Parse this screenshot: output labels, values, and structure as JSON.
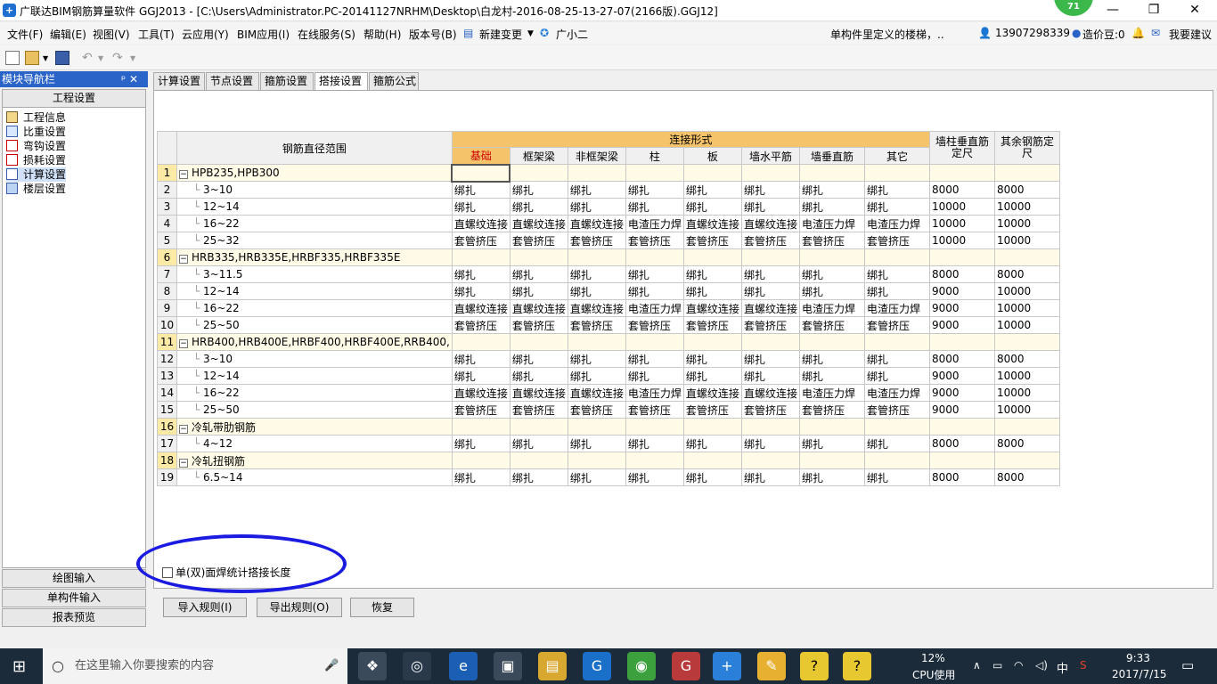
{
  "window": {
    "title": "广联达BIM钢筋算量软件 GGJ2013 - [C:\\Users\\Administrator.PC-20141127NRHM\\Desktop\\白龙村-2016-08-25-13-27-07(2166版).GGJ12]",
    "badge": "71",
    "controls": [
      "—",
      "❐",
      "✕"
    ]
  },
  "menubar": {
    "items": [
      "文件(F)",
      "编辑(E)",
      "视图(V)",
      "工具(T)",
      "云应用(Y)",
      "BIM应用(I)",
      "在线服务(S)",
      "帮助(H)",
      "版本号(B)",
      "新建变更",
      "广小二"
    ],
    "notice": "单构件里定义的楼梯，..",
    "phone": "13907298339",
    "coins": "造价豆:0",
    "suggest": "我要建议"
  },
  "nav": {
    "header": "模块导航栏",
    "pin": "ᵖ ✕",
    "section": "工程设置",
    "items": [
      "工程信息",
      "比重设置",
      "弯钩设置",
      "损耗设置",
      "计算设置",
      "楼层设置"
    ],
    "bottom": [
      "绘图输入",
      "单构件输入",
      "报表预览"
    ]
  },
  "tabs": [
    "计算设置",
    "节点设置",
    "箍筋设置",
    "搭接设置",
    "箍筋公式"
  ],
  "grid": {
    "header_range": "钢筋直径范围",
    "header_group": "连接形式",
    "columns": [
      "基础",
      "框架梁",
      "非框架梁",
      "柱",
      "板",
      "墙水平筋",
      "墙垂直筋",
      "其它"
    ],
    "header_wall": "墙柱垂直筋定尺",
    "header_other": "其余钢筋定尺",
    "rows": [
      {
        "n": "1",
        "group": true,
        "label": "HPB235,HPB300",
        "cells": [
          "",
          "",
          "",
          "",
          "",
          "",
          "",
          "",
          "",
          ""
        ]
      },
      {
        "n": "2",
        "group": false,
        "label": "3~10",
        "cells": [
          "绑扎",
          "绑扎",
          "绑扎",
          "绑扎",
          "绑扎",
          "绑扎",
          "绑扎",
          "绑扎",
          "8000",
          "8000"
        ]
      },
      {
        "n": "3",
        "group": false,
        "label": "12~14",
        "cells": [
          "绑扎",
          "绑扎",
          "绑扎",
          "绑扎",
          "绑扎",
          "绑扎",
          "绑扎",
          "绑扎",
          "10000",
          "10000"
        ]
      },
      {
        "n": "4",
        "group": false,
        "label": "16~22",
        "cells": [
          "直螺纹连接",
          "直螺纹连接",
          "直螺纹连接",
          "电渣压力焊",
          "直螺纹连接",
          "直螺纹连接",
          "电渣压力焊",
          "电渣压力焊",
          "10000",
          "10000"
        ]
      },
      {
        "n": "5",
        "group": false,
        "label": "25~32",
        "cells": [
          "套管挤压",
          "套管挤压",
          "套管挤压",
          "套管挤压",
          "套管挤压",
          "套管挤压",
          "套管挤压",
          "套管挤压",
          "10000",
          "10000"
        ]
      },
      {
        "n": "6",
        "group": true,
        "label": "HRB335,HRB335E,HRBF335,HRBF335E",
        "cells": [
          "",
          "",
          "",
          "",
          "",
          "",
          "",
          "",
          "",
          ""
        ]
      },
      {
        "n": "7",
        "group": false,
        "label": "3~11.5",
        "cells": [
          "绑扎",
          "绑扎",
          "绑扎",
          "绑扎",
          "绑扎",
          "绑扎",
          "绑扎",
          "绑扎",
          "8000",
          "8000"
        ]
      },
      {
        "n": "8",
        "group": false,
        "label": "12~14",
        "cells": [
          "绑扎",
          "绑扎",
          "绑扎",
          "绑扎",
          "绑扎",
          "绑扎",
          "绑扎",
          "绑扎",
          "9000",
          "10000"
        ]
      },
      {
        "n": "9",
        "group": false,
        "label": "16~22",
        "cells": [
          "直螺纹连接",
          "直螺纹连接",
          "直螺纹连接",
          "电渣压力焊",
          "直螺纹连接",
          "直螺纹连接",
          "电渣压力焊",
          "电渣压力焊",
          "9000",
          "10000"
        ]
      },
      {
        "n": "10",
        "group": false,
        "label": "25~50",
        "cells": [
          "套管挤压",
          "套管挤压",
          "套管挤压",
          "套管挤压",
          "套管挤压",
          "套管挤压",
          "套管挤压",
          "套管挤压",
          "9000",
          "10000"
        ]
      },
      {
        "n": "11",
        "group": true,
        "label": "HRB400,HRB400E,HRBF400,HRBF400E,RRB400,",
        "cells": [
          "",
          "",
          "",
          "",
          "",
          "",
          "",
          "",
          "",
          ""
        ]
      },
      {
        "n": "12",
        "group": false,
        "label": "3~10",
        "cells": [
          "绑扎",
          "绑扎",
          "绑扎",
          "绑扎",
          "绑扎",
          "绑扎",
          "绑扎",
          "绑扎",
          "8000",
          "8000"
        ]
      },
      {
        "n": "13",
        "group": false,
        "label": "12~14",
        "cells": [
          "绑扎",
          "绑扎",
          "绑扎",
          "绑扎",
          "绑扎",
          "绑扎",
          "绑扎",
          "绑扎",
          "9000",
          "10000"
        ]
      },
      {
        "n": "14",
        "group": false,
        "label": "16~22",
        "cells": [
          "直螺纹连接",
          "直螺纹连接",
          "直螺纹连接",
          "电渣压力焊",
          "直螺纹连接",
          "直螺纹连接",
          "电渣压力焊",
          "电渣压力焊",
          "9000",
          "10000"
        ]
      },
      {
        "n": "15",
        "group": false,
        "label": "25~50",
        "cells": [
          "套管挤压",
          "套管挤压",
          "套管挤压",
          "套管挤压",
          "套管挤压",
          "套管挤压",
          "套管挤压",
          "套管挤压",
          "9000",
          "10000"
        ]
      },
      {
        "n": "16",
        "group": true,
        "label": "冷轧带肋钢筋",
        "cells": [
          "",
          "",
          "",
          "",
          "",
          "",
          "",
          "",
          "",
          ""
        ]
      },
      {
        "n": "17",
        "group": false,
        "label": "4~12",
        "cells": [
          "绑扎",
          "绑扎",
          "绑扎",
          "绑扎",
          "绑扎",
          "绑扎",
          "绑扎",
          "绑扎",
          "8000",
          "8000"
        ]
      },
      {
        "n": "18",
        "group": true,
        "label": "冷轧扭钢筋",
        "cells": [
          "",
          "",
          "",
          "",
          "",
          "",
          "",
          "",
          "",
          ""
        ]
      },
      {
        "n": "19",
        "group": false,
        "label": "6.5~14",
        "cells": [
          "绑扎",
          "绑扎",
          "绑扎",
          "绑扎",
          "绑扎",
          "绑扎",
          "绑扎",
          "绑扎",
          "8000",
          "8000"
        ]
      }
    ]
  },
  "checkbox_label": "单(双)面焊统计搭接长度",
  "buttons": {
    "import": "导入规则(I)",
    "export": "导出规则(O)",
    "restore": "恢复"
  },
  "taskbar": {
    "search_placeholder": "在这里输入你要搜索的内容",
    "cpu": "12%",
    "cpu_label": "CPU使用",
    "ime": "中",
    "time": "9:33",
    "date": "2017/7/15"
  }
}
